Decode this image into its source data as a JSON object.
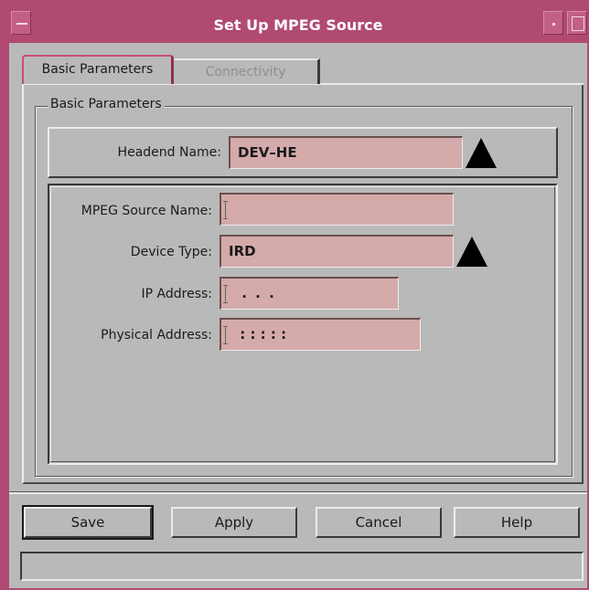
{
  "window": {
    "title": "Set Up MPEG Source",
    "accent_color": "#b04a72",
    "field_color": "#d5aaaa"
  },
  "tabs": [
    {
      "label": "Basic Parameters",
      "selected": true
    },
    {
      "label": "Connectivity",
      "selected": false
    }
  ],
  "group": {
    "legend": "Basic Parameters"
  },
  "headend": {
    "label": "Headend Name:",
    "value": "DEV–HE",
    "icon": "triangle-up-icon"
  },
  "fields": {
    "mpeg_source_name": {
      "label": "MPEG Source Name:",
      "value": ""
    },
    "device_type": {
      "label": "Device Type:",
      "value": "IRD",
      "icon": "triangle-up-icon"
    },
    "ip_address": {
      "label": "IP Address:",
      "value": " .  .  ."
    },
    "physical_address": {
      "label": "Physical Address:",
      "value": " :  :  :  :  :"
    }
  },
  "buttons": {
    "save": "Save",
    "apply": "Apply",
    "cancel": "Cancel",
    "help": "Help"
  },
  "status": {
    "text": ""
  }
}
